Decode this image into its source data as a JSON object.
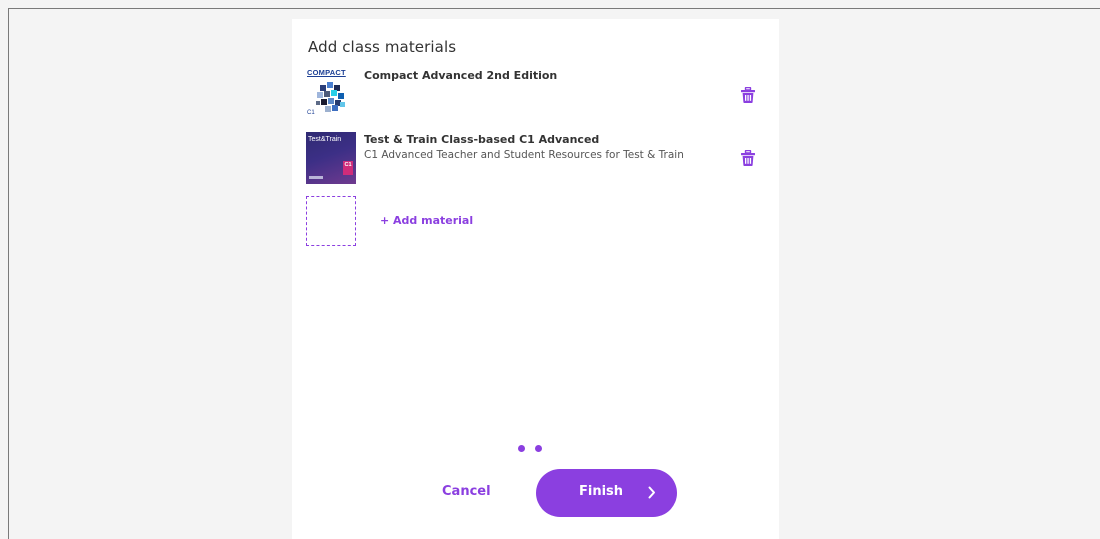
{
  "panel": {
    "title": "Add class materials"
  },
  "materials": [
    {
      "title": "Compact Advanced 2nd Edition",
      "subtitle": "",
      "thumb_brand": "COMPACT",
      "thumb_level": "C1",
      "delete_icon": "trash-icon"
    },
    {
      "title": "Test & Train Class-based C1 Advanced",
      "subtitle": "C1 Advanced Teacher and Student Resources for Test & Train",
      "thumb_brand": "Test&Train",
      "thumb_level": "C1",
      "delete_icon": "trash-icon"
    }
  ],
  "add_material": {
    "label": "+ Add material"
  },
  "pagination": {
    "dots": 2
  },
  "actions": {
    "cancel_label": "Cancel",
    "finish_label": "Finish",
    "finish_icon": "chevron-right-icon"
  },
  "colors": {
    "accent": "#8b3fe0",
    "background": "#f4f4f4",
    "panel": "#ffffff",
    "text": "#333333"
  }
}
